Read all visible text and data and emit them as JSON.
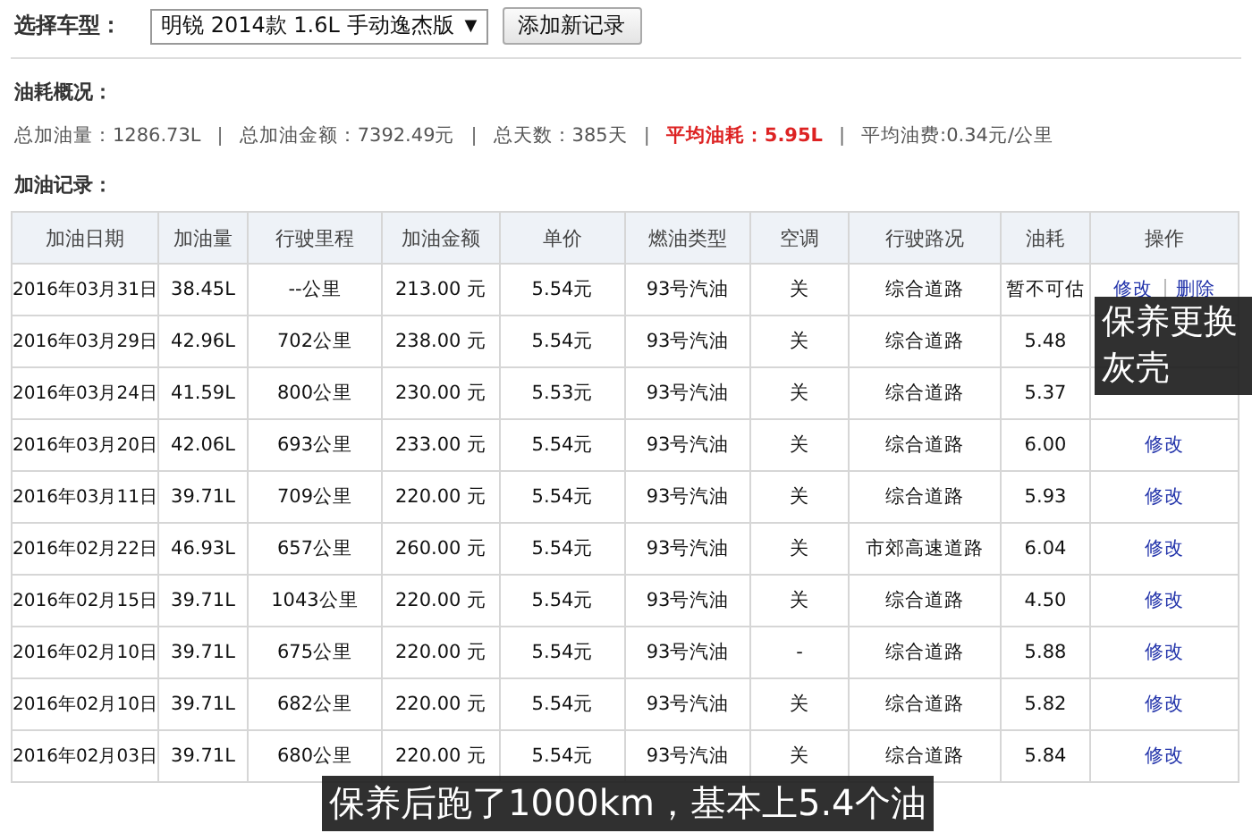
{
  "toolbar": {
    "label": "选择车型：",
    "car_select": "明锐 2014款 1.6L 手动逸杰版",
    "dropdown_arrow": "▼",
    "add_button": "添加新记录"
  },
  "summary": {
    "title": "油耗概况：",
    "items": [
      {
        "text": "总加油量：1286.73L",
        "highlight": false
      },
      {
        "text": "总加油金额：7392.49元",
        "highlight": false
      },
      {
        "text": "总天数：385天",
        "highlight": false
      },
      {
        "text": "平均油耗：5.95L",
        "highlight": true
      },
      {
        "text": "平均油费:0.34元/公里",
        "highlight": false
      }
    ],
    "separator": "|"
  },
  "records": {
    "title": "加油记录：",
    "columns": [
      "加油日期",
      "加油量",
      "行驶里程",
      "加油金额",
      "单价",
      "燃油类型",
      "空调",
      "行驶路况",
      "油耗",
      "操作"
    ],
    "rows": [
      {
        "cells": [
          "2016年03月31日",
          "38.45L",
          "--公里",
          "213.00 元",
          "5.54元",
          "93号汽油",
          "关",
          "综合道路",
          "暂不可估"
        ],
        "actions": [
          "修改",
          "删除"
        ]
      },
      {
        "cells": [
          "2016年03月29日",
          "42.96L",
          "702公里",
          "238.00 元",
          "5.54元",
          "93号汽油",
          "关",
          "综合道路",
          "5.48"
        ],
        "actions": []
      },
      {
        "cells": [
          "2016年03月24日",
          "41.59L",
          "800公里",
          "230.00 元",
          "5.53元",
          "93号汽油",
          "关",
          "综合道路",
          "5.37"
        ],
        "actions": []
      },
      {
        "cells": [
          "2016年03月20日",
          "42.06L",
          "693公里",
          "233.00 元",
          "5.54元",
          "93号汽油",
          "关",
          "综合道路",
          "6.00"
        ],
        "actions": [
          "修改"
        ]
      },
      {
        "cells": [
          "2016年03月11日",
          "39.71L",
          "709公里",
          "220.00 元",
          "5.54元",
          "93号汽油",
          "关",
          "综合道路",
          "5.93"
        ],
        "actions": [
          "修改"
        ]
      },
      {
        "cells": [
          "2016年02月22日",
          "46.93L",
          "657公里",
          "260.00 元",
          "5.54元",
          "93号汽油",
          "关",
          "市郊高速道路",
          "6.04"
        ],
        "actions": [
          "修改"
        ]
      },
      {
        "cells": [
          "2016年02月15日",
          "39.71L",
          "1043公里",
          "220.00 元",
          "5.54元",
          "93号汽油",
          "关",
          "综合道路",
          "4.50"
        ],
        "actions": [
          "修改"
        ]
      },
      {
        "cells": [
          "2016年02月10日",
          "39.71L",
          "675公里",
          "220.00 元",
          "5.54元",
          "93号汽油",
          "-",
          "综合道路",
          "5.88"
        ],
        "actions": [
          "修改"
        ]
      },
      {
        "cells": [
          "2016年02月10日",
          "39.71L",
          "682公里",
          "220.00 元",
          "5.54元",
          "93号汽油",
          "关",
          "综合道路",
          "5.82"
        ],
        "actions": [
          "修改"
        ]
      },
      {
        "cells": [
          "2016年02月03日",
          "39.71L",
          "680公里",
          "220.00 元",
          "5.54元",
          "93号汽油",
          "关",
          "综合道路",
          "5.84"
        ],
        "actions": [
          "修改"
        ]
      }
    ]
  },
  "captions": [
    {
      "kind": "side",
      "text": "保养更换灰壳"
    },
    {
      "kind": "bottom",
      "text": "保养后跑了1000km，基本上5.4个油"
    }
  ]
}
